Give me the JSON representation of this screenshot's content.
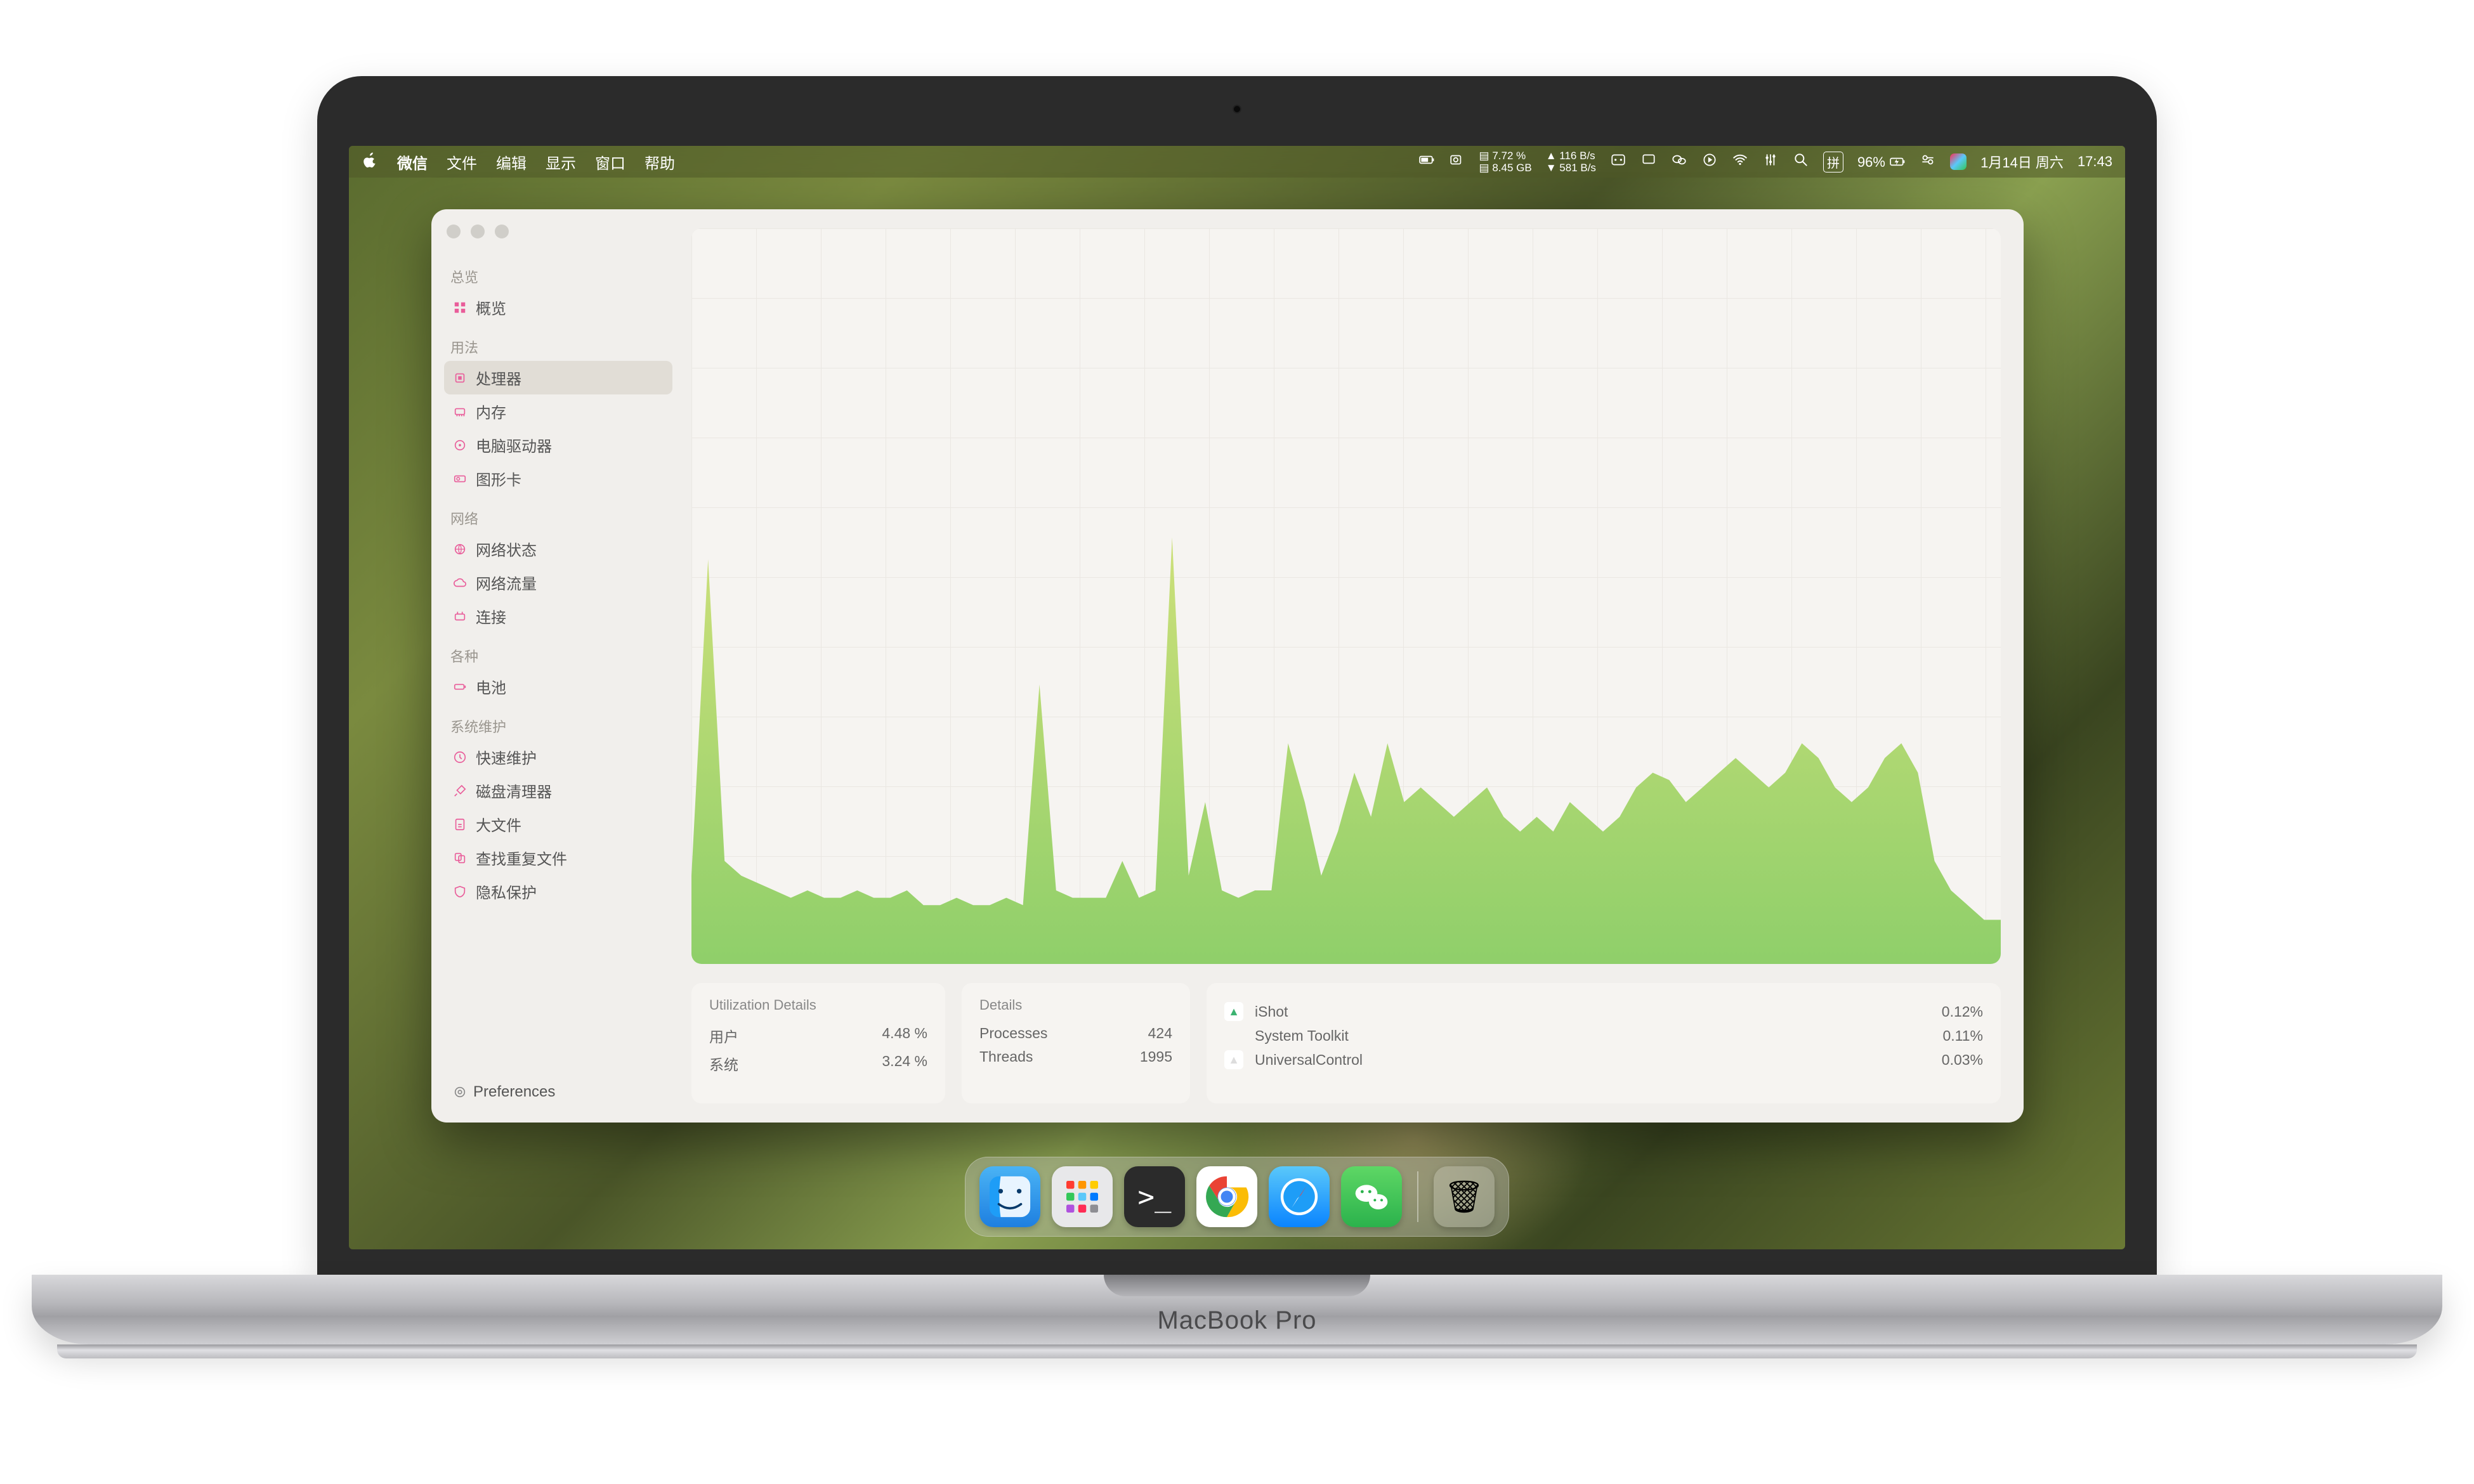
{
  "menubar": {
    "app_name": "微信",
    "items": [
      "文件",
      "编辑",
      "显示",
      "窗口",
      "帮助"
    ],
    "cpu_pct": "7.72 %",
    "ram": "8.45 GB",
    "net_up": "116 B/s",
    "net_down": "581 B/s",
    "battery": "96%",
    "ime": "拼",
    "date": "1月14日 周六",
    "time": "17:43"
  },
  "brand": "MacBook Pro",
  "sidebar": {
    "sections": [
      {
        "header": "总览",
        "items": [
          {
            "icon": "grid",
            "label": "概览"
          }
        ]
      },
      {
        "header": "用法",
        "items": [
          {
            "icon": "cpu",
            "label": "处理器",
            "active": true
          },
          {
            "icon": "memory",
            "label": "内存"
          },
          {
            "icon": "disk",
            "label": "电脑驱动器"
          },
          {
            "icon": "gpu",
            "label": "图形卡"
          }
        ]
      },
      {
        "header": "网络",
        "items": [
          {
            "icon": "globe",
            "label": "网络状态"
          },
          {
            "icon": "cloud",
            "label": "网络流量"
          },
          {
            "icon": "plug",
            "label": "连接"
          }
        ]
      },
      {
        "header": "各种",
        "items": [
          {
            "icon": "battery",
            "label": "电池"
          }
        ]
      },
      {
        "header": "系统维护",
        "items": [
          {
            "icon": "bolt",
            "label": "快速维护"
          },
          {
            "icon": "broom",
            "label": "磁盘清理器"
          },
          {
            "icon": "bigfile",
            "label": "大文件"
          },
          {
            "icon": "dupe",
            "label": "查找重复文件"
          },
          {
            "icon": "shield",
            "label": "隐私保护"
          }
        ]
      }
    ],
    "preferences": "Preferences"
  },
  "panels": {
    "util": {
      "title": "Utilization Details",
      "rows": [
        {
          "label": "用户",
          "value": "4.48 %"
        },
        {
          "label": "系统",
          "value": "3.24 %"
        }
      ]
    },
    "details": {
      "title": "Details",
      "rows": [
        {
          "label": "Processes",
          "value": "424"
        },
        {
          "label": "Threads",
          "value": "1995"
        }
      ]
    },
    "procs": [
      {
        "name": "iShot",
        "pct": "0.12%",
        "color": "#3cb371"
      },
      {
        "name": "System Toolkit",
        "pct": "0.11%",
        "color": "transparent"
      },
      {
        "name": "UniversalControl",
        "pct": "0.03%",
        "color": "#ddd"
      }
    ]
  },
  "chart_data": {
    "type": "area",
    "title": "",
    "xlabel": "",
    "ylabel": "",
    "ylim": [
      0,
      100
    ],
    "x": [
      0,
      1,
      2,
      3,
      4,
      5,
      6,
      7,
      8,
      9,
      10,
      11,
      12,
      13,
      14,
      15,
      16,
      17,
      18,
      19,
      20,
      21,
      22,
      23,
      24,
      25,
      26,
      27,
      28,
      29,
      30,
      31,
      32,
      33,
      34,
      35,
      36,
      37,
      38,
      39,
      40,
      41,
      42,
      43,
      44,
      45,
      46,
      47,
      48,
      49,
      50,
      51,
      52,
      53,
      54,
      55,
      56,
      57,
      58,
      59,
      60,
      61,
      62,
      63,
      64,
      65,
      66,
      67,
      68,
      69,
      70,
      71,
      72,
      73,
      74,
      75,
      76,
      77,
      78,
      79
    ],
    "series": [
      {
        "name": "cpu",
        "color_top": "#cde07a",
        "color_bottom": "#8fcf6a",
        "values": [
          12,
          55,
          14,
          12,
          11,
          10,
          9,
          10,
          9,
          9,
          10,
          9,
          9,
          10,
          8,
          8,
          9,
          8,
          8,
          9,
          8,
          38,
          10,
          9,
          9,
          9,
          14,
          9,
          10,
          58,
          12,
          22,
          10,
          9,
          10,
          10,
          30,
          22,
          12,
          18,
          26,
          20,
          30,
          22,
          24,
          22,
          20,
          22,
          24,
          20,
          18,
          20,
          18,
          22,
          20,
          18,
          20,
          24,
          26,
          25,
          22,
          24,
          26,
          28,
          26,
          24,
          26,
          30,
          28,
          24,
          22,
          24,
          28,
          30,
          26,
          14,
          10,
          8,
          6,
          6
        ]
      }
    ]
  },
  "dock": {
    "apps": [
      {
        "name": "finder",
        "bg": "linear-gradient(#4ab3f5,#1e7fe0)",
        "glyph": "◡"
      },
      {
        "name": "launchpad",
        "bg": "#e8e8ea",
        "glyph": "⊞"
      },
      {
        "name": "terminal",
        "bg": "#2b2b2b",
        "glyph": ">"
      },
      {
        "name": "chrome",
        "bg": "#fff",
        "glyph": "◎"
      },
      {
        "name": "safari",
        "bg": "linear-gradient(#5ac8fa,#0a84ff)",
        "glyph": "✦"
      },
      {
        "name": "wechat",
        "bg": "linear-gradient(#5ed765,#2bb24c)",
        "glyph": "✉"
      }
    ],
    "trash": "🗑"
  }
}
